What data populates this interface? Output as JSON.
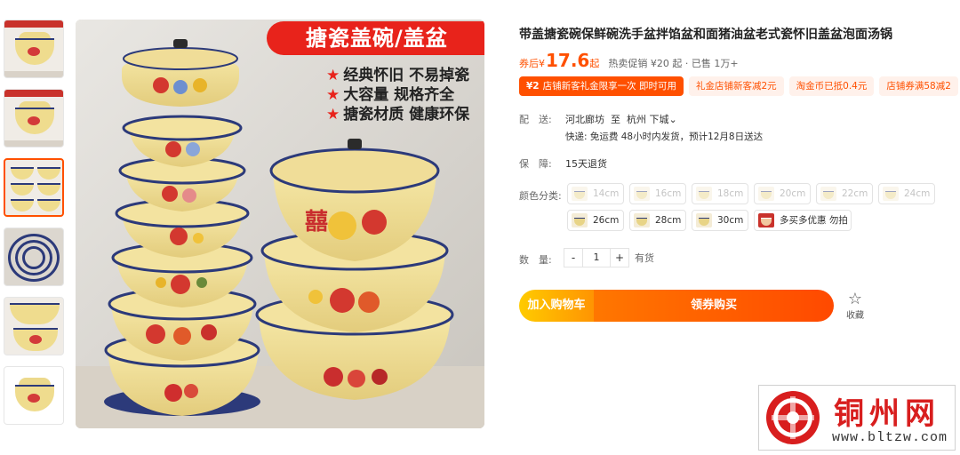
{
  "thumbnails": [
    {
      "caption": "thumb-1"
    },
    {
      "caption": "thumb-2"
    },
    {
      "caption": "thumb-3"
    },
    {
      "caption": "thumb-4"
    },
    {
      "caption": "thumb-5"
    },
    {
      "caption": "thumb-6"
    }
  ],
  "hero": {
    "banner": "搪瓷盖碗/盖盆",
    "features": [
      "经典怀旧 不易掉瓷",
      "大容量 规格齐全",
      "搪瓷材质 健康环保"
    ],
    "star": "★",
    "double_happiness": "囍"
  },
  "product": {
    "title": "带盖搪瓷碗保鲜碗洗手盆拌馅盆和面猪油盆老式瓷怀旧盖盆泡面汤锅",
    "price_prefix": "券后¥",
    "price": "17.6",
    "price_suffix": "起",
    "hot_sale": "热卖促销 ¥20 起 · 已售 1万+"
  },
  "coupons": {
    "primary_amount": "¥2",
    "primary_text": "店铺新客礼金限享一次 即时可用",
    "c2": "礼金店铺新客减2元",
    "c3": "淘金币已抵0.4元",
    "c4": "店铺券满58减2"
  },
  "shipping": {
    "label": "配　送:",
    "from": "河北廊坊",
    "to_word": "至",
    "dest": "杭州 下城",
    "dest_arrow": "⌄",
    "detail": "快递: 免运费  48小时内发货，预计12月8日送达"
  },
  "guarantee": {
    "label": "保　障:",
    "value": "15天退货"
  },
  "colors": {
    "label": "颜色分类:",
    "options": [
      "14cm",
      "16cm",
      "18cm",
      "20cm",
      "22cm",
      "24cm",
      "26cm",
      "28cm",
      "30cm",
      "多买多优惠 勿拍"
    ]
  },
  "quantity": {
    "label": "数　量:",
    "minus": "-",
    "value": "1",
    "plus": "+",
    "stock": "有货"
  },
  "actions": {
    "add_to_cart": "加入购物车",
    "buy": "领券购买",
    "fav_icon": "☆",
    "fav_label": "收藏"
  },
  "watermark": {
    "title": "铜州网",
    "url": "www.bltzw.com"
  },
  "theme": {
    "accent": "#ff5000",
    "banner_red": "#e8231b",
    "enamel_cream": "#efdc8e",
    "rim_blue": "#2c3a7a"
  }
}
